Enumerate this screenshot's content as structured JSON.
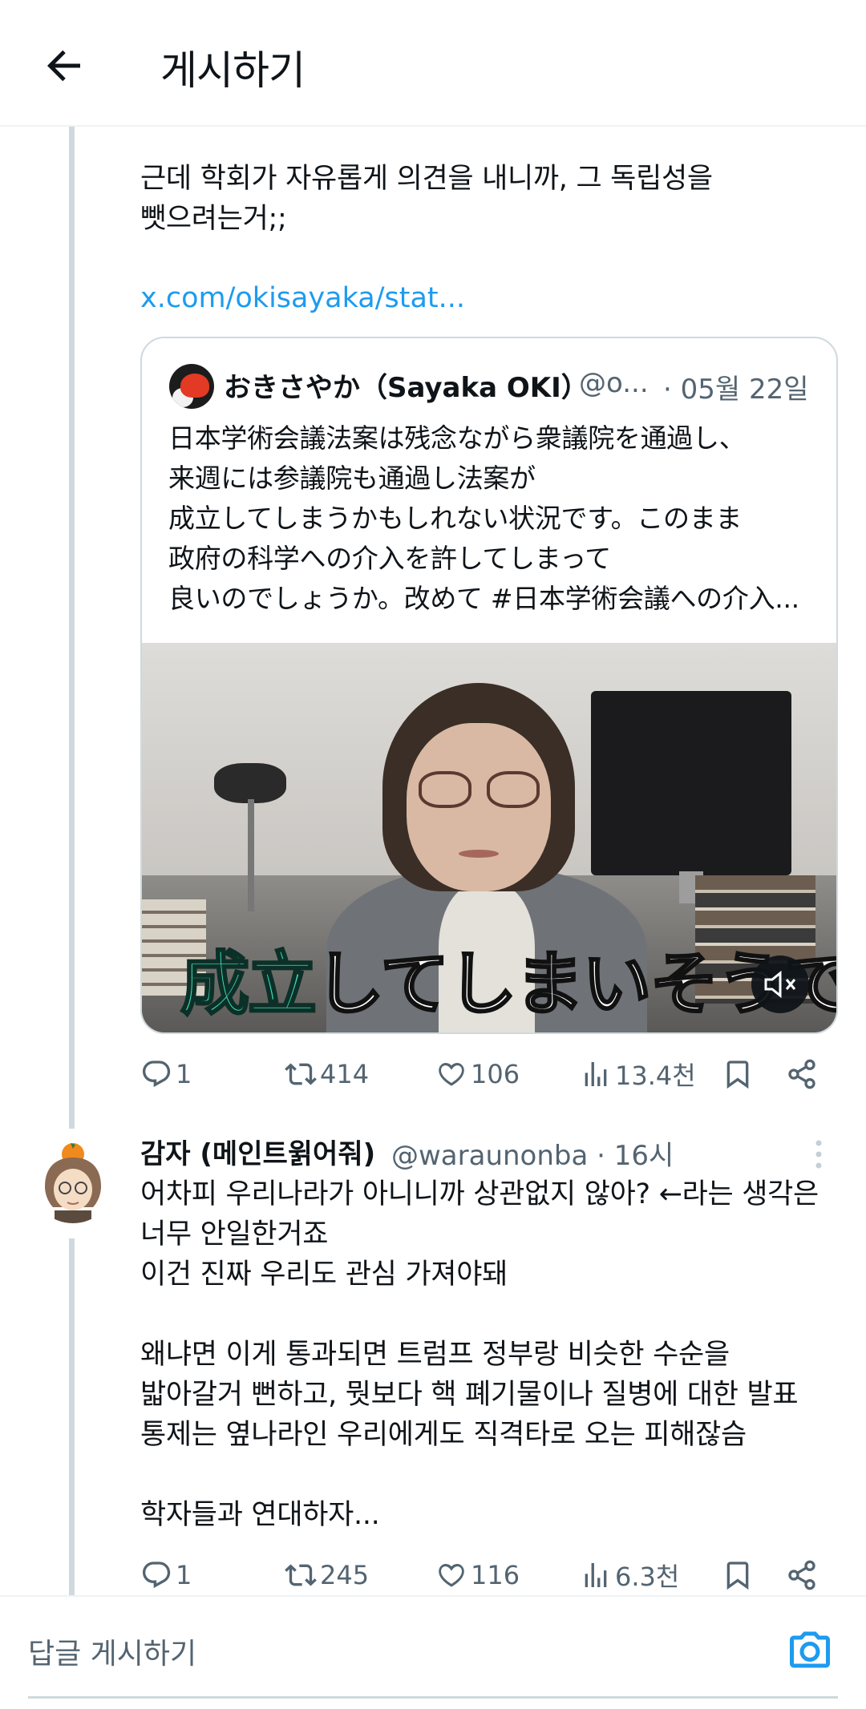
{
  "header": {
    "title": "게시하기"
  },
  "post1": {
    "text_lines": [
      "근데 학회가 자유롭게 의견을 내니까, 그 독립성을",
      "뺏으려는거;;"
    ],
    "link": "x.com/okisayaka/stat...",
    "quote": {
      "name": "おきさやか（Sayaka OKI）",
      "handle": "@o...",
      "date": "· 05월 22일",
      "text_lines": [
        "日本学術会議法案は残念ながら衆議院を通過し、",
        "来週には参議院も通過し法案が",
        "成立してしまうかもしれない状況です。このまま",
        "政府の科学への介入を許してしまって",
        "良いのでしょうか。改めて #日本学術会議への介入..."
      ],
      "video_caption_accent": "成立",
      "video_caption_rest": "してしまいそうです"
    },
    "stats": {
      "replies": "1",
      "reposts": "414",
      "likes": "106",
      "views": "13.4천"
    }
  },
  "post2": {
    "name": "감자 (메인트윍어줘)",
    "handle_time": "@waraunonba · 16시",
    "text_lines": [
      "어차피 우리나라가 아니니까 상관없지 않아? ←라는 생각은",
      "너무 안일한거죠",
      "이건 진짜 우리도 관심 가져야돼",
      "",
      "왜냐면 이게 통과되면 트럼프 정부랑 비슷한 수순을",
      "밟아갈거 뻔하고, 뭣보다 핵 폐기물이나 질병에 대한 발표",
      "통제는 옆나라인 우리에게도 직격타로 오는 피해잖슴",
      "",
      "학자들과 연대하자..."
    ],
    "stats": {
      "replies": "1",
      "reposts": "245",
      "likes": "116",
      "views": "6.3천"
    }
  },
  "reply_bar": {
    "placeholder": "답글 게시하기"
  },
  "colors": {
    "link": "#1d9bf0",
    "muted": "#536471",
    "line": "#cfd9de",
    "caption_accent": "#3ee0b8"
  }
}
